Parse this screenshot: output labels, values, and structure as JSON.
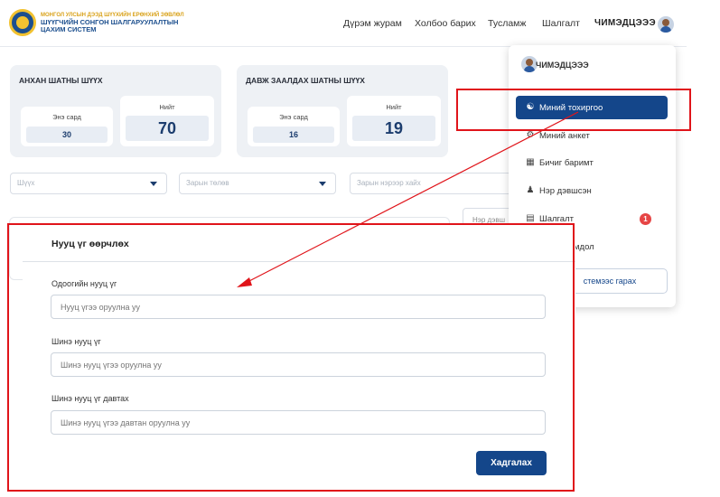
{
  "header": {
    "org_line1": "МОНГОЛ УЛСЫН ДЭЭД ШҮҮХИЙН ЕРӨНХИЙ ЗӨВЛӨЛ",
    "org_line2": "ШҮҮГЧИЙН СОНГОН ШАЛГАРУУЛАЛТЫН",
    "org_line3": "ЦАХИМ СИСТЕМ",
    "nav": [
      "Дүрэм журам",
      "Холбоо барих",
      "Тусламж",
      "Шалгалт"
    ],
    "user_name": "ЧИМЭДЦЭЭЭ"
  },
  "stats": [
    {
      "title": "АНХАН ШАТНЫ ШҮҮХ",
      "month_label": "Энэ сард",
      "month_value": "30",
      "total_label": "Нийт",
      "total_value": "70"
    },
    {
      "title": "ДАВЖ ЗААЛДАХ ШАТНЫ ШҮҮХ",
      "month_label": "Энэ сард",
      "month_value": "16",
      "total_label": "Нийт",
      "total_value": "19"
    }
  ],
  "filters": {
    "court_placeholder": "Шүүх",
    "race_type_placeholder": "Зарын төлөв",
    "race_name_placeholder": "Зарын нэрээр хайх"
  },
  "background": {
    "button_fragment": "Нэр дэвш"
  },
  "dropdown": {
    "user_name": "ЧИМЭДЦЭЭЭ",
    "items": [
      {
        "label": "Миний тохиргоо",
        "icon": "user-icon"
      },
      {
        "label": "Миний анкет",
        "icon": "profile-icon"
      },
      {
        "label": "Бичиг баримт",
        "icon": "document-icon"
      },
      {
        "label": "Нэр дэвшсэн",
        "icon": "add-user-icon"
      },
      {
        "label": "Шалгалт",
        "icon": "calendar-icon",
        "badge": "1"
      },
      {
        "label": "мдол",
        "icon": "info-icon"
      }
    ],
    "logout_label": "стемээс гарах"
  },
  "modal": {
    "title": "Нууц үг өөрчлөх",
    "current_label": "Одоогийн нууц үг",
    "current_placeholder": "Нууц үгээ оруулна уу",
    "new_label": "Шинэ нууц үг",
    "new_placeholder": "Шинэ нууц үгээ оруулна уу",
    "confirm_label": "Шинэ нууц үг давтах",
    "confirm_placeholder": "Шинэ нууц үгээ давтан оруулна уу",
    "save_label": "Хадгалах"
  },
  "colors": {
    "primary": "#14468a",
    "highlight": "#e0141a",
    "badge": "#e64545"
  }
}
